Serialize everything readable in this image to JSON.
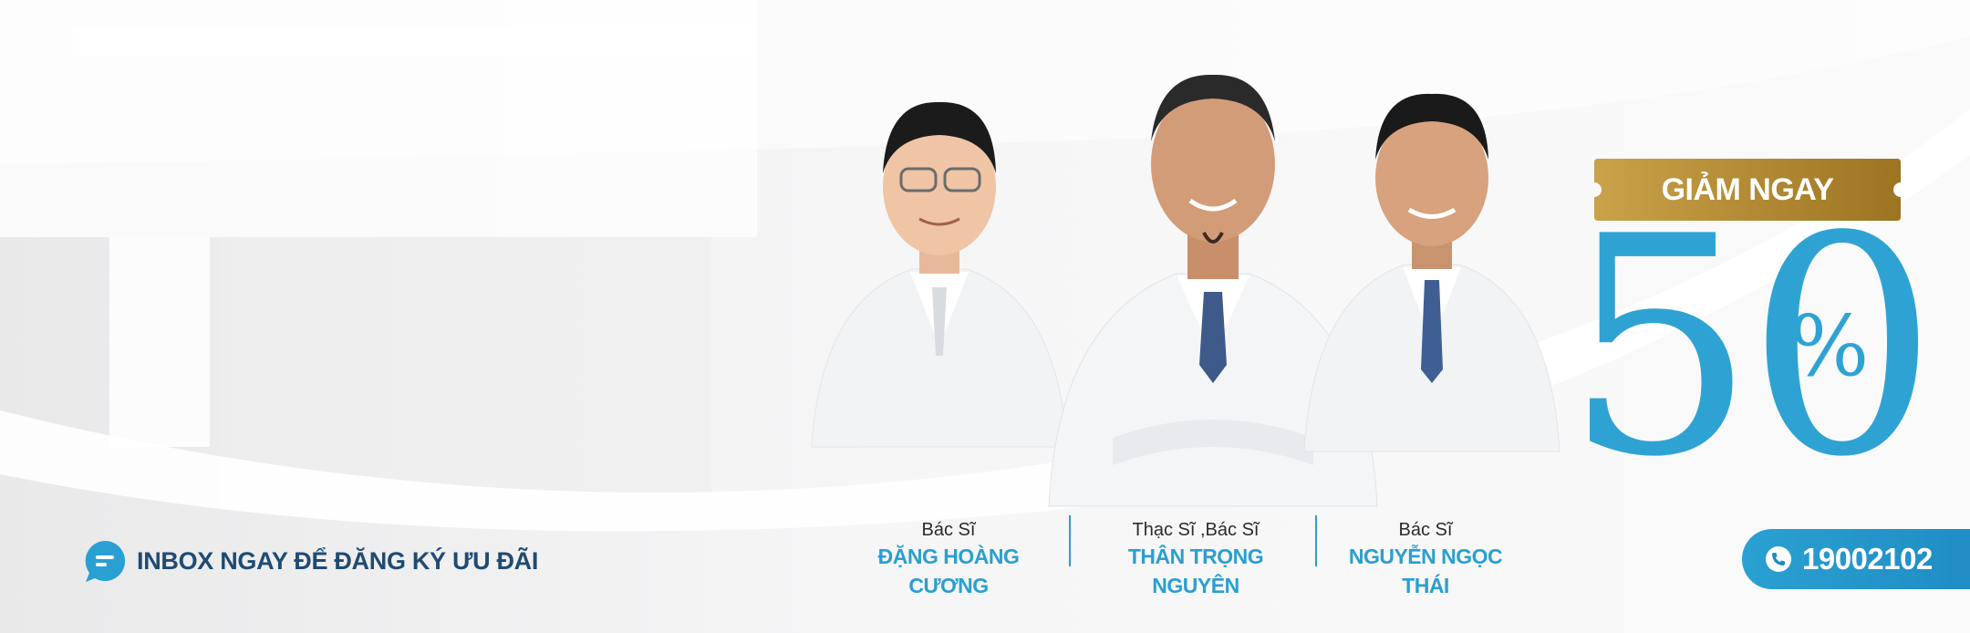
{
  "inbox": {
    "label": "INBOX NGAY ĐỂ ĐĂNG KÝ ƯU ĐÃI"
  },
  "doctors": [
    {
      "role": "Bác Sĩ",
      "name": "ĐẶNG HOÀNG CƯƠNG"
    },
    {
      "role": "Thạc Sĩ ,Bác Sĩ",
      "name": "THÂN TRỌNG NGUYÊN"
    },
    {
      "role": "Bác Sĩ",
      "name": "NGUYỄN NGỌC THÁI"
    }
  ],
  "promo": {
    "tag": "GIẢM NGAY",
    "value": "50",
    "unit": "%"
  },
  "hotline": {
    "number": "19002102"
  },
  "colors": {
    "accent_blue": "#2ea3d3",
    "navy_text": "#1f4b73",
    "gold_start": "#c9a24a",
    "gold_end": "#9d7421"
  },
  "icons": {
    "inbox": "chat-bubble-icon",
    "phone": "phone-icon"
  }
}
